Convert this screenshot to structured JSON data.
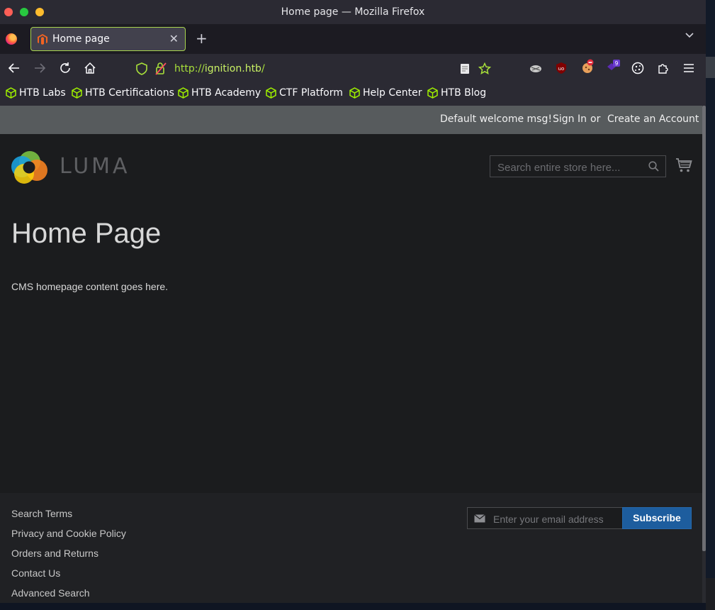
{
  "window": {
    "title": "Home page — Mozilla Firefox"
  },
  "tab": {
    "label": "Home page",
    "close_glyph": "✕",
    "new_tab_glyph": "+"
  },
  "navbar": {
    "url_scheme": "http://",
    "url_host": "ignition.htb",
    "url_path": "/",
    "extension_badge": "9"
  },
  "bookmarks": [
    {
      "label": "HTB Labs"
    },
    {
      "label": "HTB Certifications"
    },
    {
      "label": "HTB Academy"
    },
    {
      "label": "CTF Platform"
    },
    {
      "label": "Help Center"
    },
    {
      "label": "HTB Blog"
    }
  ],
  "store": {
    "welcome": "Default welcome msg!",
    "sign_in": "Sign In",
    "or": "or",
    "create_account": "Create an Account",
    "logo_text": "LUMA",
    "search_placeholder": "Search entire store here...",
    "page_title": "Home Page",
    "cms_text": "CMS homepage content goes here."
  },
  "footer": {
    "links": [
      "Search Terms",
      "Privacy and Cookie Policy",
      "Orders and Returns",
      "Contact Us",
      "Advanced Search"
    ],
    "newsletter_placeholder": "Enter your email address",
    "subscribe_label": "Subscribe"
  },
  "colors": {
    "accent_green": "#a8d44e",
    "subscribe_blue": "#1d5d9e",
    "header_panel": "#575b5d",
    "page_bg": "#1b1c1e"
  }
}
